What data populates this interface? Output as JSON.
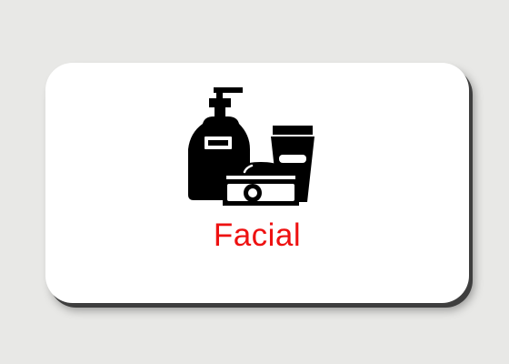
{
  "card": {
    "label": "Facial",
    "icon": "cosmetics-icon",
    "label_color": "#ee1111",
    "icon_color": "#000000"
  }
}
